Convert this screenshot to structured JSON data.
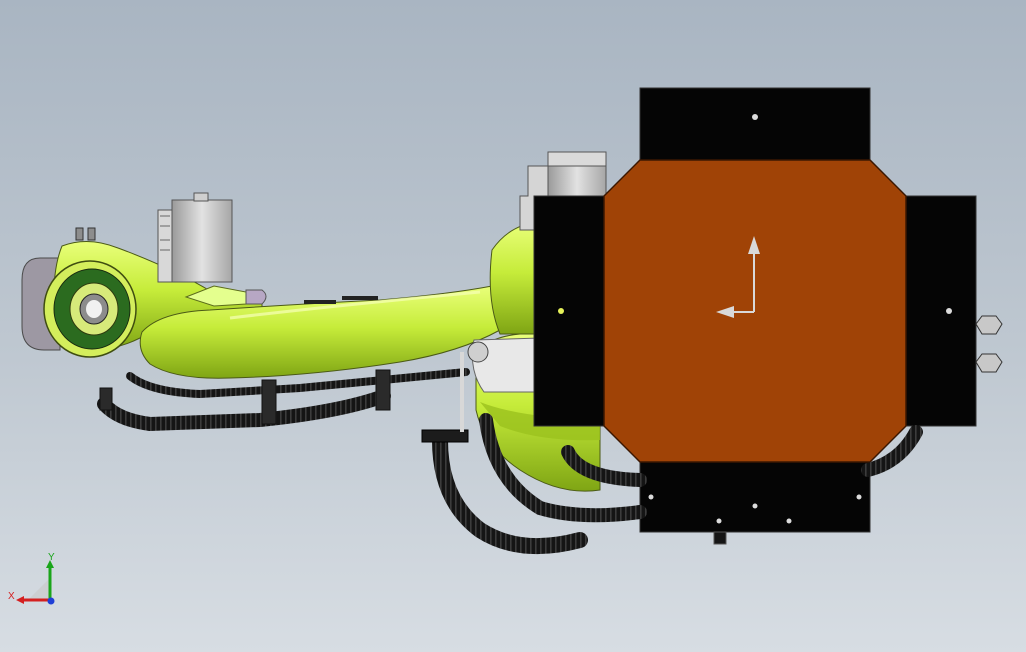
{
  "viewport": {
    "background_top": "#a9b5c2",
    "background_bottom": "#d7dde3"
  },
  "model": {
    "arm_color": "#c6ec3a",
    "plate_color": "#a04306",
    "bracket_color": "#050505",
    "motor_color": "#bfbfbf",
    "hose_color": "#1a1a1a",
    "bearing_color": "#2b6b1f"
  },
  "triad": {
    "y_label": "Y",
    "x_label": "X",
    "y_color": "#1aa51a",
    "x_color": "#d42020",
    "z_color": "#1f3fd6"
  }
}
